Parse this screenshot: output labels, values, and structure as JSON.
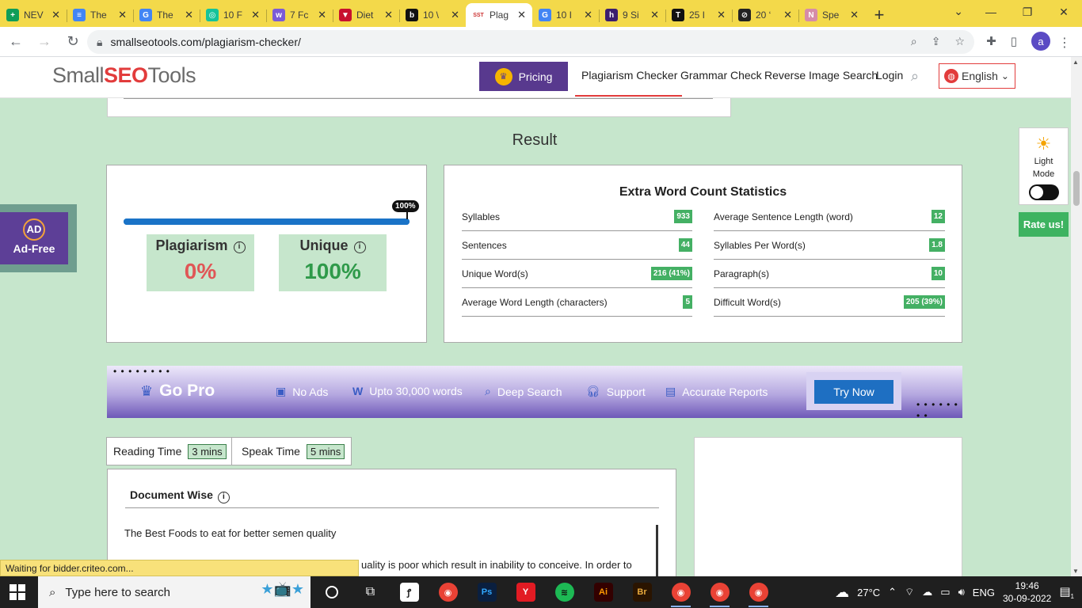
{
  "browser": {
    "tabs": [
      {
        "title": "NEV",
        "icon": "sheets-icon",
        "color": "#0f9d58",
        "glyph": "+"
      },
      {
        "title": "The",
        "icon": "docs-icon",
        "color": "#4285f4",
        "glyph": "≡"
      },
      {
        "title": "The",
        "icon": "google-icon",
        "color": "#4285f4",
        "glyph": "G"
      },
      {
        "title": "10 F",
        "icon": "grammarly-icon",
        "color": "#15c39a",
        "glyph": "◎"
      },
      {
        "title": "7 Fc",
        "icon": "wix-icon",
        "color": "#7b5bd6",
        "glyph": "w"
      },
      {
        "title": "Diet",
        "icon": "shield-icon",
        "color": "#c8102e",
        "glyph": "▼"
      },
      {
        "title": "10 \\",
        "icon": "bold-b-icon",
        "color": "#111111",
        "glyph": "b"
      },
      {
        "title": "Plag",
        "icon": "sst-icon",
        "color": "#ffffff",
        "glyph": "SST"
      },
      {
        "title": "10 I",
        "icon": "google-icon",
        "color": "#4285f4",
        "glyph": "G"
      },
      {
        "title": "9 Si",
        "icon": "h-icon",
        "color": "#3b1e6e",
        "glyph": "h"
      },
      {
        "title": "25 I",
        "icon": "t-icon",
        "color": "#111111",
        "glyph": "T"
      },
      {
        "title": "20 ‘",
        "icon": "compass-icon",
        "color": "#222222",
        "glyph": "⊘"
      },
      {
        "title": "Spe",
        "icon": "n-icon",
        "color": "#d68ca8",
        "glyph": "N"
      }
    ],
    "active_tab_index": 7,
    "url": "smallseotools.com/plagiarism-checker/",
    "profile_initial": "a"
  },
  "site": {
    "logo_left": "Small",
    "logo_mid": "SEO",
    "logo_right": "Tools",
    "pricing_label": "Pricing",
    "nav": [
      "Plagiarism Checker",
      "Grammar Check",
      "Reverse Image Search",
      "Login"
    ],
    "language": "English"
  },
  "result": {
    "title": "Result",
    "progress_percent": 100,
    "progress_label": "100%",
    "plagiarism_label": "Plagiarism",
    "plagiarism_value": "0%",
    "unique_label": "Unique",
    "unique_value": "100%"
  },
  "stats": {
    "title": "Extra Word Count Statistics",
    "left": [
      {
        "label": "Syllables",
        "value": "933"
      },
      {
        "label": "Sentences",
        "value": "44"
      },
      {
        "label": "Unique Word(s)",
        "value": "216 (41%)"
      },
      {
        "label": "Average Word Length (characters)",
        "value": "5"
      }
    ],
    "right": [
      {
        "label": "Average Sentence Length (word)",
        "value": "12"
      },
      {
        "label": "Syllables Per Word(s)",
        "value": "1.8"
      },
      {
        "label": "Paragraph(s)",
        "value": "10"
      },
      {
        "label": "Difficult Word(s)",
        "value": "205 (39%)"
      }
    ]
  },
  "gopro": {
    "title": "Go Pro",
    "features": [
      "No Ads",
      "Upto 30,000 words",
      "Deep Search",
      "Support",
      "Accurate Reports"
    ],
    "cta": "Try Now"
  },
  "timing": {
    "reading_label": "Reading Time",
    "reading_value": "3 mins",
    "speak_label": "Speak Time",
    "speak_value": "5 mins"
  },
  "document": {
    "heading": "Document Wise",
    "line1": "The Best Foods to eat for better semen quality",
    "line2": "uality is poor which result in inability to conceive. In order to"
  },
  "widgets": {
    "adfree_badge": "AD",
    "adfree_label": "Ad-Free",
    "light_mode_label": "Light Mode",
    "rate_label": "Rate us!"
  },
  "status_text": "Waiting for bidder.criteo.com...",
  "taskbar": {
    "search_placeholder": "Type here to search",
    "temperature": "27°C",
    "language": "ENG",
    "time": "19:46",
    "date": "30-09-2022",
    "notification_count": "1"
  }
}
